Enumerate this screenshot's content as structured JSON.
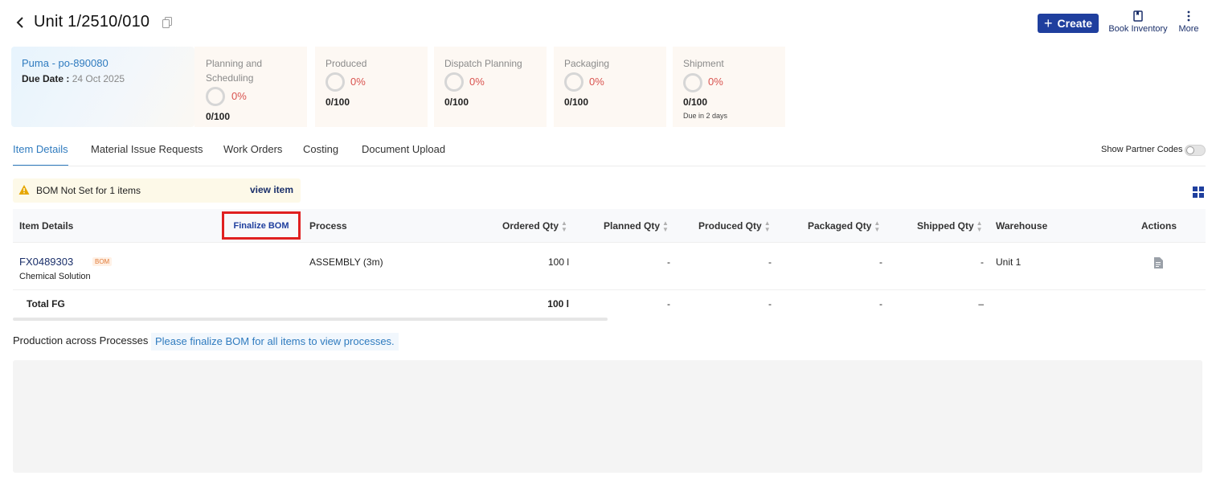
{
  "header": {
    "title": "Unit 1/2510/010",
    "create_label": "Create",
    "book_inventory_label": "Book Inventory",
    "more_label": "More"
  },
  "summary": {
    "po_link": "Puma - po-890080",
    "due_label": "Due Date :",
    "due_value": "24 Oct 2025"
  },
  "stages": [
    {
      "label": "Planning and Scheduling",
      "percent": "0%",
      "count": "0/100",
      "progress": 0
    },
    {
      "label": "Produced",
      "percent": "0%",
      "count": "0/100",
      "progress": 0
    },
    {
      "label": "Dispatch Planning",
      "percent": "0%",
      "count": "0/100",
      "progress": 0
    },
    {
      "label": "Packaging",
      "percent": "0%",
      "count": "0/100",
      "progress": 0
    },
    {
      "label": "Shipment",
      "percent": "0%",
      "count": "0/100",
      "note": "Due in 2 days",
      "progress": 0
    }
  ],
  "tabs": [
    "Item Details",
    "Material Issue Requests",
    "Work Orders",
    "Costing",
    "Document Upload"
  ],
  "active_tab": "Item Details",
  "partner_codes_label": "Show Partner Codes",
  "partner_codes_on": false,
  "warning": {
    "text": "BOM Not Set for 1 items",
    "action": "view item"
  },
  "table": {
    "columns": {
      "item_details": "Item Details",
      "finalize_bom": "Finalize BOM",
      "process": "Process",
      "ordered_qty": "Ordered Qty",
      "planned_qty": "Planned Qty",
      "produced_qty": "Produced Qty",
      "packaged_qty": "Packaged Qty",
      "shipped_qty": "Shipped Qty",
      "warehouse": "Warehouse",
      "actions": "Actions"
    },
    "rows": [
      {
        "code": "FX0489303",
        "badge": "BOM",
        "name": "Chemical Solution",
        "process": "ASSEMBLY (3m)",
        "ordered_qty": "100 l",
        "planned_qty": "-",
        "produced_qty": "-",
        "packaged_qty": "-",
        "shipped_qty": "-",
        "warehouse": "Unit 1"
      }
    ],
    "total": {
      "label": "Total FG",
      "ordered_qty": "100 l",
      "planned_qty": "-",
      "produced_qty": "-",
      "packaged_qty": "-",
      "shipped_qty": "–"
    }
  },
  "production": {
    "label": "Production across Processes",
    "message": "Please finalize BOM for all items to view processes."
  },
  "colors": {
    "primary": "#1f3f9e",
    "link": "#2f7bbf",
    "percent": "#d9534f",
    "highlight_border": "#e02020",
    "warning_bg": "#fdf9e8",
    "warning_icon": "#e6a700"
  }
}
